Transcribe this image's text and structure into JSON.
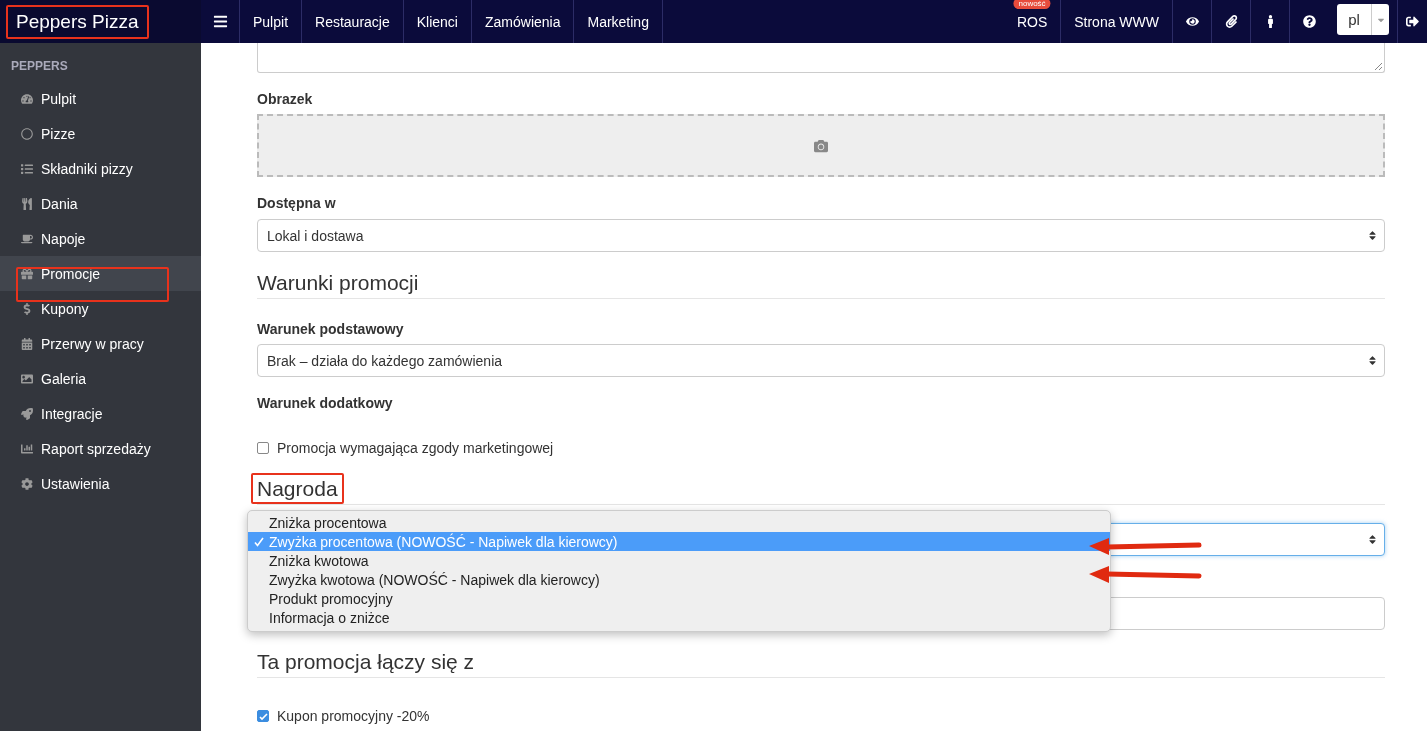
{
  "brand": "Peppers Pizza",
  "topnav": {
    "items": [
      {
        "label": "Pulpit"
      },
      {
        "label": "Restauracje"
      },
      {
        "label": "Klienci"
      },
      {
        "label": "Zamówienia"
      },
      {
        "label": "Marketing"
      }
    ],
    "right": [
      {
        "label": "ROS",
        "badge": "nowość"
      },
      {
        "label": "Strona WWW"
      }
    ],
    "language": "pl"
  },
  "sidebar": {
    "header": "PEPPERS",
    "items": [
      {
        "label": "Pulpit",
        "selected": false
      },
      {
        "label": "Pizze",
        "selected": false
      },
      {
        "label": "Składniki pizzy",
        "selected": false
      },
      {
        "label": "Dania",
        "selected": false
      },
      {
        "label": "Napoje",
        "selected": false
      },
      {
        "label": "Promocje",
        "selected": true
      },
      {
        "label": "Kupony",
        "selected": false
      },
      {
        "label": "Przerwy w pracy",
        "selected": false
      },
      {
        "label": "Galeria",
        "selected": false
      },
      {
        "label": "Integracje",
        "selected": false
      },
      {
        "label": "Raport sprzedaży",
        "selected": false
      },
      {
        "label": "Ustawienia",
        "selected": false
      }
    ]
  },
  "form": {
    "image_label": "Obrazek",
    "available_label": "Dostępna w",
    "available_value": "Lokal i dostawa",
    "conditions_heading": "Warunki promocji",
    "basic_condition_label": "Warunek podstawowy",
    "basic_condition_value": "Brak – działa do każdego zamówienia",
    "extra_condition_label": "Warunek dodatkowy",
    "marketing_consent": {
      "label": "Promocja wymagająca zgody marketingowej",
      "checked": false
    },
    "reward_heading": "Nagroda",
    "reward_options": [
      {
        "label": "Zniżka procentowa",
        "selected": false
      },
      {
        "label": "Zwyżka procentowa (NOWOŚĆ - Napiwek dla kierowcy)",
        "selected": true
      },
      {
        "label": "Zniżka kwotowa",
        "selected": false
      },
      {
        "label": "Zwyżka kwotowa (NOWOŚĆ - Napiwek dla kierowcy)",
        "selected": false
      },
      {
        "label": "Produkt promocyjny",
        "selected": false
      },
      {
        "label": "Informacja o zniżce",
        "selected": false
      }
    ],
    "combine_heading": "Ta promocja łączy się z",
    "combine_items": [
      {
        "label": "Kupon promocyjny -20%",
        "checked": true
      }
    ]
  }
}
